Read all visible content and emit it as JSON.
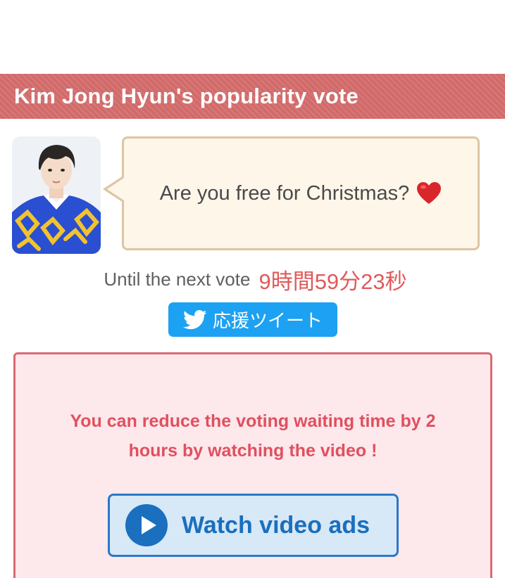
{
  "header": {
    "title": "Kim Jong Hyun's popularity vote"
  },
  "message": {
    "text": "Are you free for Christmas?",
    "emoji_icon": "red-heart-icon"
  },
  "timer": {
    "label": "Until the next vote",
    "value": "9時間59分23秒"
  },
  "tweet_button": {
    "label": "応援ツイート",
    "icon": "twitter-bird-icon"
  },
  "ad": {
    "description": "You can reduce the voting waiting time by 2 hours by watching the video !",
    "button_label": "Watch video ads",
    "button_icon": "play-circle-icon"
  },
  "colors": {
    "header_bg": "#d26a6a",
    "bubble_bg": "#fff6ea",
    "bubble_border": "#dcc6a2",
    "timer_accent": "#e05a5a",
    "twitter_blue": "#1da1f2",
    "ad_bg": "#fde8ec",
    "ad_border": "#d96a73",
    "ad_text": "#e0505e",
    "watch_button_bg": "#d7e8f7",
    "watch_button_accent": "#1a6fbe"
  }
}
